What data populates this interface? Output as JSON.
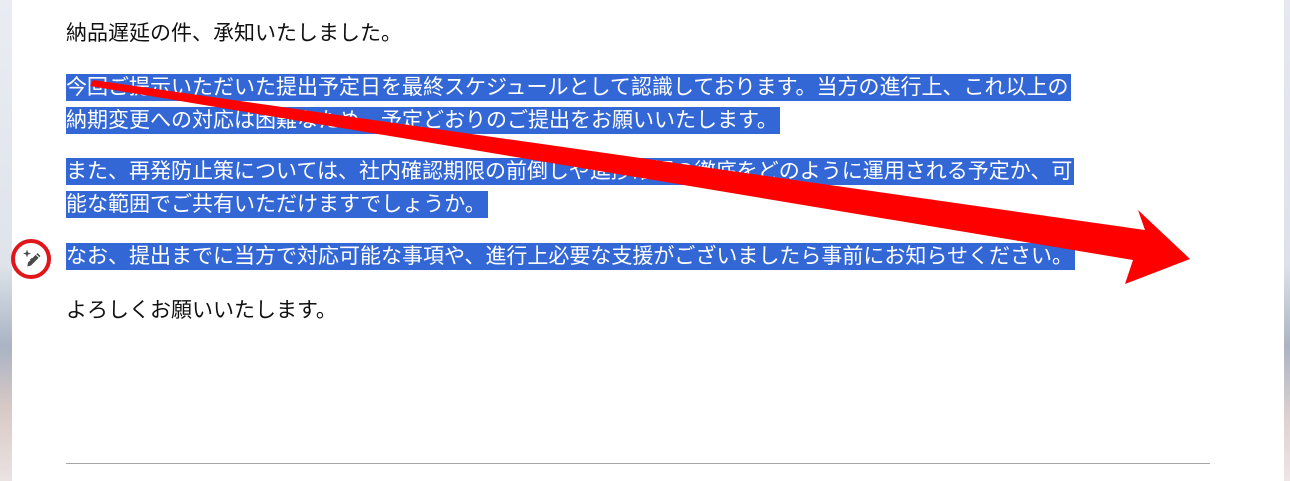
{
  "document": {
    "paragraphs": [
      {
        "lines": [
          "納品遅延の件、承知いたしました。"
        ],
        "selected": false
      },
      {
        "lines": [
          "今回ご提示いただいた提出予定日を最終スケジュールとして認識しております。当方の進行上、これ以上の",
          "納期変更への対応は困難なため、予定どおりのご提出をお願いいたします。"
        ],
        "selected": true
      },
      {
        "lines": [
          "また、再発防止策については、社内確認期限の前倒しや進捗確認の徹底をどのように運用される予定か、可",
          "能な範囲でご共有いただけますでしょうか。"
        ],
        "selected": true
      },
      {
        "lines": [
          "なお、提出までに当方で対応可能な事項や、進行上必要な支援がございましたら事前にお知らせください。"
        ],
        "selected": true
      },
      {
        "lines": [
          "よろしくお願いいたします。"
        ],
        "selected": false
      }
    ]
  },
  "ai_write_button": {
    "icon": "pen-sparkle-icon"
  },
  "annotations": {
    "arrow_color": "#ff0000",
    "circle_color": "#e0161b",
    "arrow_direction": "left-to-right across selection"
  },
  "colors": {
    "selection": "#3367d6",
    "text": "#111111",
    "page": "#ffffff"
  }
}
